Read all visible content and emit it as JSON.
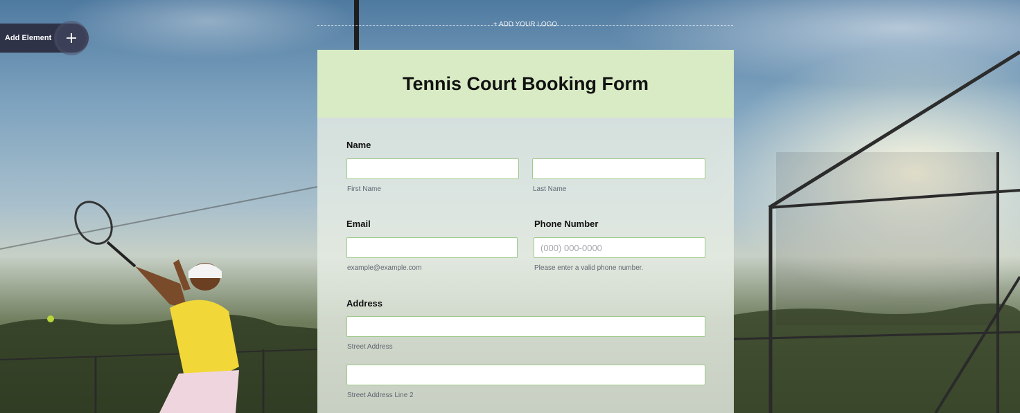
{
  "add_element": {
    "label": "Add Element",
    "icon": "plus-icon"
  },
  "logo": {
    "label": "+ ADD YOUR LOGO"
  },
  "form": {
    "title": "Tennis Court Booking Form",
    "header_color": "#d8ebc4",
    "name": {
      "label": "Name",
      "first_sublabel": "First Name",
      "last_sublabel": "Last Name",
      "first_value": "",
      "last_value": ""
    },
    "email": {
      "label": "Email",
      "sublabel": "example@example.com",
      "value": ""
    },
    "phone": {
      "label": "Phone Number",
      "placeholder": "(000) 000-0000",
      "sublabel": "Please enter a valid phone number.",
      "value": ""
    },
    "address": {
      "label": "Address",
      "street_sublabel": "Street Address",
      "street2_sublabel": "Street Address Line 2",
      "street_value": "",
      "street2_value": ""
    }
  }
}
